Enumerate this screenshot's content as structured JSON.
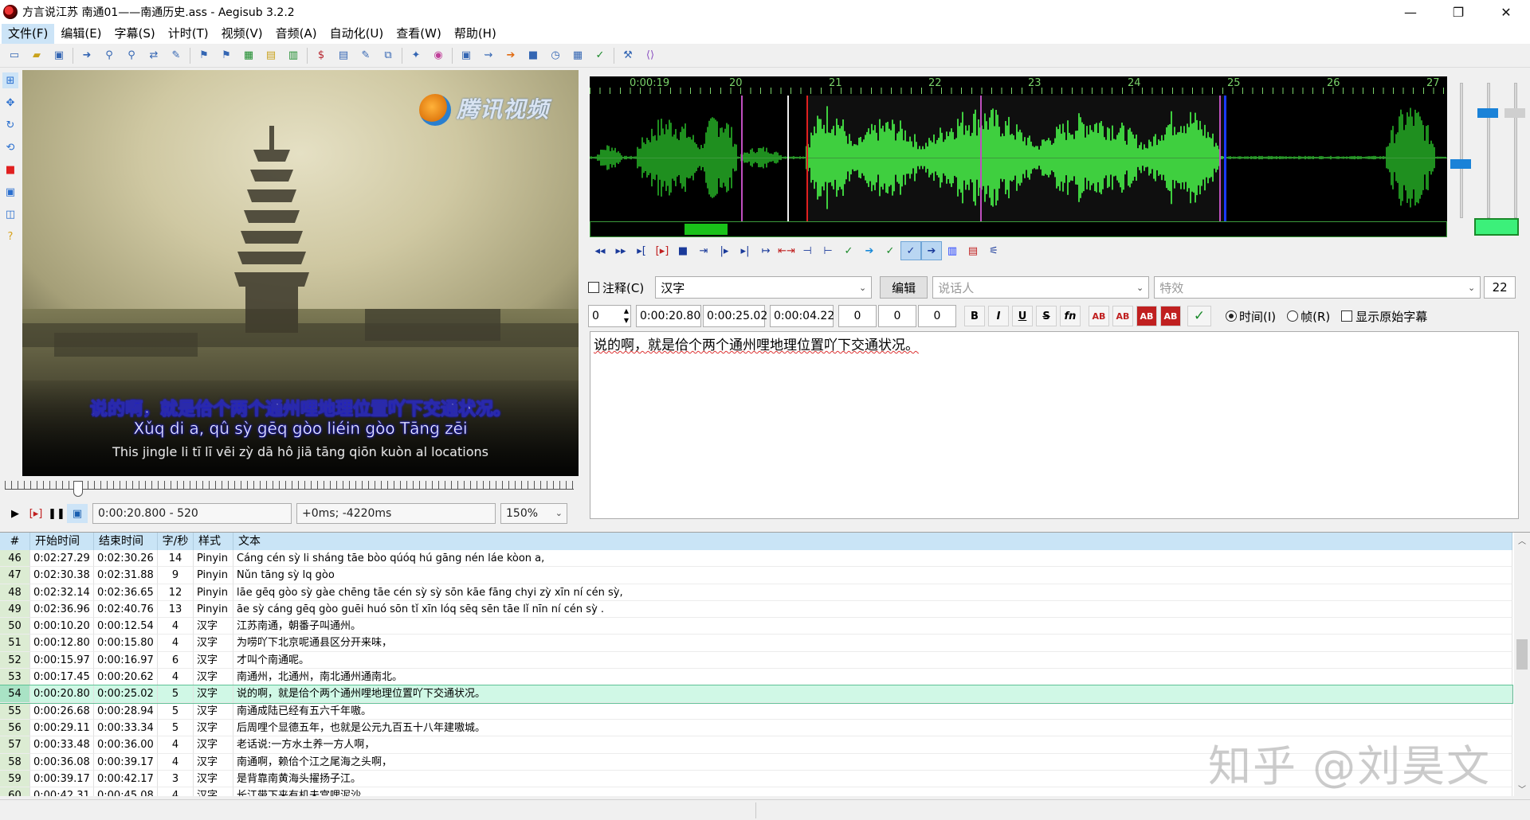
{
  "window": {
    "title": "方言说江苏 南通01——南通历史.ass - Aegisub 3.2.2",
    "minimize": "—",
    "maximize": "❐",
    "close": "✕"
  },
  "menu": [
    "文件(F)",
    "编辑(E)",
    "字幕(S)",
    "计时(T)",
    "视频(V)",
    "音频(A)",
    "自动化(U)",
    "查看(W)",
    "帮助(H)"
  ],
  "video": {
    "watermark": "腾讯视频",
    "subtitle_line1": "说的啊，就是佮个两个通州哩地理位置吖下交通状况。",
    "subtitle_line2": "Xǔq di a, qû sỳ gēq gòo liéin gòo Tāng zēi",
    "subtitle_line3": "This jingle li tī lī vēi zỳ dā hô jiā tāng qiōn kuòn al locations",
    "time_field": "0:00:20.800 - 520",
    "offset_field": "+0ms; -4220ms",
    "zoom": "150%"
  },
  "audio": {
    "timeline_labels": [
      "0:00:19",
      "20",
      "21",
      "22",
      "23",
      "24",
      "25",
      "26",
      "27"
    ],
    "colors": {
      "wave": "#3fcf3f",
      "wave_dim": "#1f8f1f",
      "start_marker": "#e02020",
      "end_marker": "#1a3aff",
      "keyframe": "#c04fc0"
    }
  },
  "edit": {
    "comment_label": "注释(C)",
    "style": "汉字",
    "edit_button": "编辑",
    "actor_placeholder": "说话人",
    "effect_placeholder": "特效",
    "char_count": "22",
    "layer": "0",
    "start_time": "0:00:20.80",
    "end_time": "0:00:25.02",
    "duration": "0:00:04.22",
    "margin_l": "0",
    "margin_r": "0",
    "margin_v": "0",
    "bold": "B",
    "italic": "I",
    "underline": "U",
    "strike": "S",
    "fn": "fn",
    "color_ab": "AB",
    "time_radio": "时间(I)",
    "frame_radio": "帧(R)",
    "show_original": "显示原始字幕",
    "text": "说的啊，就是佮个两个通州哩地理位置吖下交通状况。"
  },
  "grid": {
    "headers": [
      "#",
      "开始时间",
      "结束时间",
      "字/秒",
      "样式",
      "文本"
    ],
    "rows": [
      {
        "n": "46",
        "start": "0:02:27.29",
        "end": "0:02:30.26",
        "cps": "14",
        "style": "Pinyin",
        "text": "Cáng cén sỳ li sháng tāe bòo qúóq hú gāng nén láe kòon a,"
      },
      {
        "n": "47",
        "start": "0:02:30.38",
        "end": "0:02:31.88",
        "cps": "9",
        "style": "Pinyin",
        "text": "Nǔn tāng sỳ lq gòo"
      },
      {
        "n": "48",
        "start": "0:02:32.14",
        "end": "0:02:36.65",
        "cps": "12",
        "style": "Pinyin",
        "text": "lāe gēq gòo sỳ gàe chēng tāe cén sỳ sỳ sōn kāe fāng chyi zỳ xīn ní cén sỳ,"
      },
      {
        "n": "49",
        "start": "0:02:36.96",
        "end": "0:02:40.76",
        "cps": "13",
        "style": "Pinyin",
        "text": "āe sỳ cáng gēq gòo guēi huó sōn tǐ xīn lóq sēq sēn tāe lǐ nīn ní cén sỳ ."
      },
      {
        "n": "50",
        "start": "0:00:10.20",
        "end": "0:00:12.54",
        "cps": "4",
        "style": "汉字",
        "text": "江苏南通，朝番子叫通州。"
      },
      {
        "n": "51",
        "start": "0:00:12.80",
        "end": "0:00:15.80",
        "cps": "4",
        "style": "汉字",
        "text": "为唠吖下北京呢通县区分开来味，"
      },
      {
        "n": "52",
        "start": "0:00:15.97",
        "end": "0:00:16.97",
        "cps": "6",
        "style": "汉字",
        "text": "才叫个南通呢。"
      },
      {
        "n": "53",
        "start": "0:00:17.45",
        "end": "0:00:20.62",
        "cps": "4",
        "style": "汉字",
        "text": "南通州，北通州，南北通州通南北。"
      },
      {
        "n": "54",
        "start": "0:00:20.80",
        "end": "0:00:25.02",
        "cps": "5",
        "style": "汉字",
        "text": "说的啊，就是佮个两个通州哩地理位置吖下交通状况。"
      },
      {
        "n": "55",
        "start": "0:00:26.68",
        "end": "0:00:28.94",
        "cps": "5",
        "style": "汉字",
        "text": "南通成陆已经有五六千年嗷。"
      },
      {
        "n": "56",
        "start": "0:00:29.11",
        "end": "0:00:33.34",
        "cps": "5",
        "style": "汉字",
        "text": "后周哩个显德五年，也就是公元九百五十八年建嗷城。"
      },
      {
        "n": "57",
        "start": "0:00:33.48",
        "end": "0:00:36.00",
        "cps": "4",
        "style": "汉字",
        "text": "老话说:一方水土养一方人啊，"
      },
      {
        "n": "58",
        "start": "0:00:36.08",
        "end": "0:00:39.17",
        "cps": "4",
        "style": "汉字",
        "text": "南通啊，赖佮个江之尾海之头啊，"
      },
      {
        "n": "59",
        "start": "0:00:39.17",
        "end": "0:00:42.17",
        "cps": "3",
        "style": "汉字",
        "text": "是背靠南黄海头擢扬子江。"
      },
      {
        "n": "60",
        "start": "0:00:42.31",
        "end": "0:00:45.08",
        "cps": "4",
        "style": "汉字",
        "text": "长江带下来有机未宫哩泥沙"
      }
    ],
    "selected_index": 8
  },
  "overlay": {
    "zhihu_watermark": "知乎 @刘昊文"
  }
}
